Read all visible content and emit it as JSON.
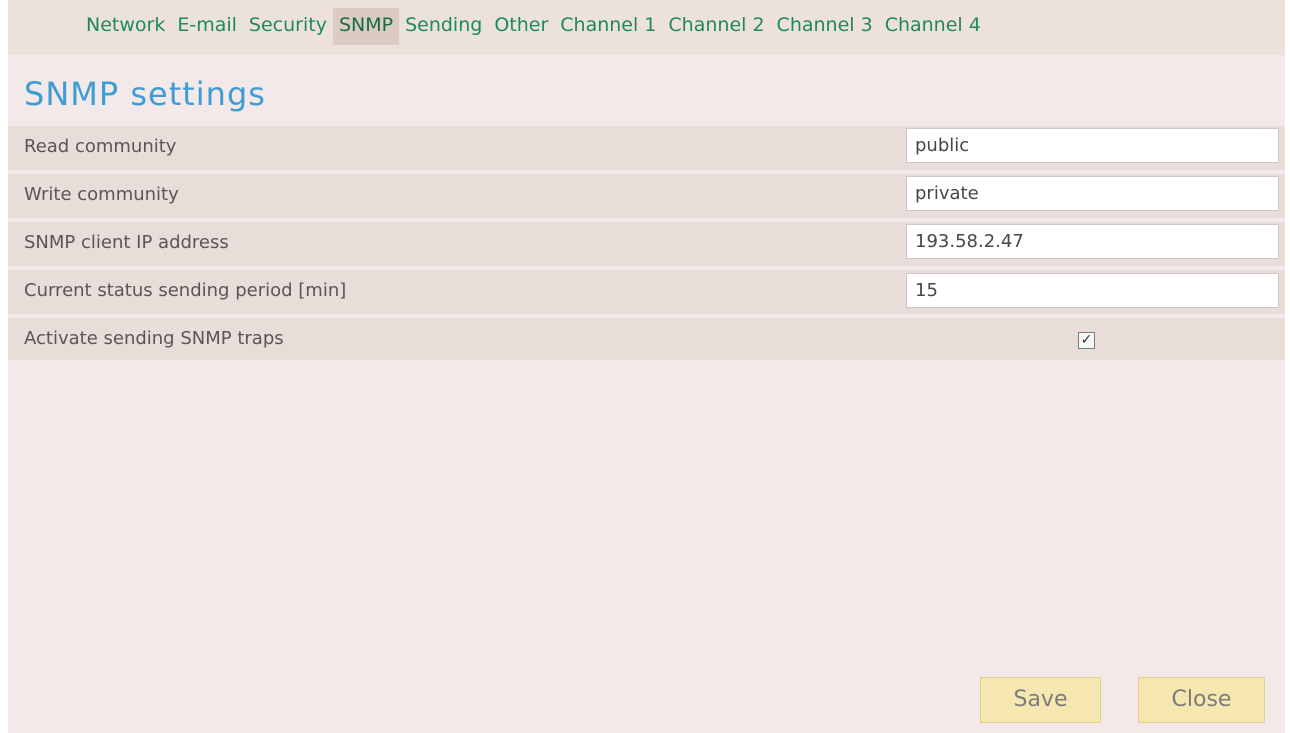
{
  "tabs": [
    {
      "label": "Network"
    },
    {
      "label": "E-mail"
    },
    {
      "label": "Security"
    },
    {
      "label": "SNMP",
      "active": true
    },
    {
      "label": "Sending"
    },
    {
      "label": "Other"
    },
    {
      "label": "Channel 1"
    },
    {
      "label": "Channel 2"
    },
    {
      "label": "Channel 3"
    },
    {
      "label": "Channel 4"
    }
  ],
  "page_title": "SNMP settings",
  "fields": {
    "read_community": {
      "label": "Read community",
      "value": "public"
    },
    "write_community": {
      "label": "Write community",
      "value": "private"
    },
    "client_ip": {
      "label": "SNMP client IP address",
      "value": "193.58.2.47"
    },
    "status_period": {
      "label": "Current status sending period [min]",
      "value": "15"
    },
    "traps": {
      "label": "Activate sending SNMP traps",
      "checked": true,
      "check_glyph": "✓"
    }
  },
  "buttons": {
    "save": "Save",
    "close": "Close"
  },
  "colors": {
    "tab_text": "#1e8a58",
    "title": "#3f9dd6",
    "button_bg": "#f6e7b0"
  }
}
